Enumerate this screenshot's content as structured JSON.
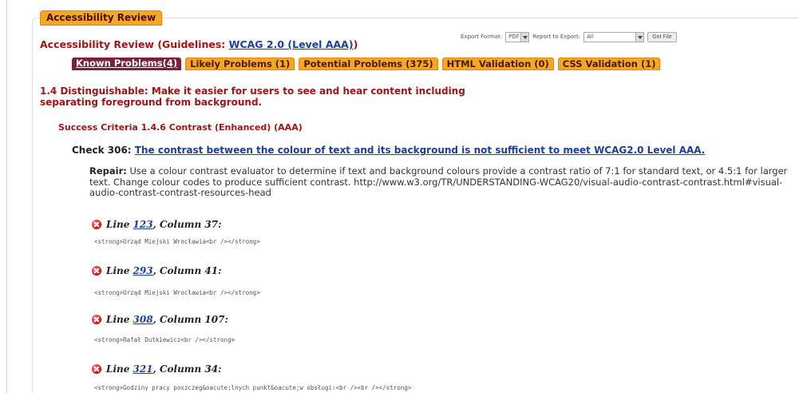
{
  "panel": {
    "title": "Accessibility Review"
  },
  "review_heading": {
    "prefix": "Accessibility Review (Guidelines: ",
    "link": "WCAG 2.0 (Level AAA)",
    "suffix": ")"
  },
  "export": {
    "format_label": "Export Format:",
    "format_value": "PDF",
    "report_label": "Report to Export:",
    "report_value": "All",
    "get_file_label": "Get File"
  },
  "tabs": [
    {
      "label": "Known Problems(4)",
      "active": true
    },
    {
      "label": "Likely Problems (1)",
      "active": false
    },
    {
      "label": "Potential Problems (375)",
      "active": false
    },
    {
      "label": "HTML Validation (0)",
      "active": false
    },
    {
      "label": "CSS Validation (1)",
      "active": false
    }
  ],
  "guideline": "1.4 Distinguishable: Make it easier for users to see and hear content including separating foreground from background.",
  "criteria": "Success Criteria 1.4.6 Contrast (Enhanced) (AAA)",
  "check": {
    "prefix": "Check 306: ",
    "link": "The contrast between the colour of text and its background is not sufficient to meet WCAG2.0 Level AAA."
  },
  "repair": {
    "label": "Repair:",
    "text": "Use a colour contrast evaluator to determine if text and background colours provide a contrast ratio of 7:1 for standard text, or 4.5:1 for larger text. Change colour codes to produce sufficient contrast. http://www.w3.org/TR/UNDERSTANDING-WCAG20/visual-audio-contrast-contrast.html#visual-audio-contrast-contrast-resources-head"
  },
  "issues": [
    {
      "line_label": "Line ",
      "line": "123",
      "col_label": ", Column 37",
      "suffix": ":",
      "code": "<strong>Urząd Miejski Wrocławia<br /></strong>"
    },
    {
      "line_label": "Line ",
      "line": "293",
      "col_label": ", Column 41",
      "suffix": ":",
      "code": "<strong>Urząd Miejski Wrocławia<br /></strong>"
    },
    {
      "line_label": "Line ",
      "line": "308",
      "col_label": ", Column 107",
      "suffix": ":",
      "code": "<strong>Rafał Dutkiewicz<br /></strong>"
    },
    {
      "line_label": "Line ",
      "line": "321",
      "col_label": ", Column 34",
      "suffix": ":",
      "code": "<strong>Godziny pracy poszczeg&oacute;lnych punkt&oacute;w obsługi:<br /><br /></strong>"
    }
  ],
  "colors": {
    "tab_active": "#7a1f3d",
    "tab_inactive": "#f5a623",
    "heading_red": "#a01616",
    "link_blue": "#1c3f9c"
  },
  "icons": {
    "issue_marker": "error-x-icon"
  }
}
